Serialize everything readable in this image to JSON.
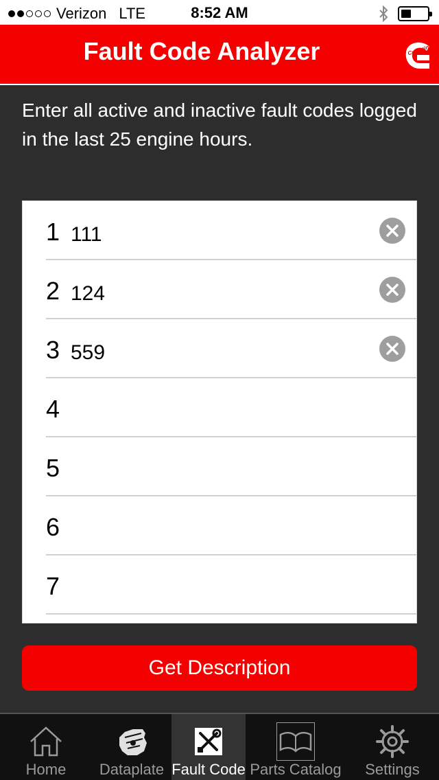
{
  "status_bar": {
    "carrier": "Verizon",
    "network": "LTE",
    "time": "8:52 AM"
  },
  "header": {
    "title": "Fault Code Analyzer",
    "logo_text": "Cummins"
  },
  "instructions": "Enter all active and inactive fault codes logged in the last 25 engine hours.",
  "codes": [
    {
      "number": "1",
      "value": "111"
    },
    {
      "number": "2",
      "value": "124"
    },
    {
      "number": "3",
      "value": "559"
    },
    {
      "number": "4",
      "value": ""
    },
    {
      "number": "5",
      "value": ""
    },
    {
      "number": "6",
      "value": ""
    },
    {
      "number": "7",
      "value": ""
    }
  ],
  "get_description_label": "Get Description",
  "tabs": [
    {
      "label": "Home",
      "icon": "home-icon"
    },
    {
      "label": "Dataplate",
      "icon": "engine-icon"
    },
    {
      "label": "Fault Code",
      "icon": "tools-icon",
      "active": true
    },
    {
      "label": "Parts Catalog",
      "icon": "book-icon"
    },
    {
      "label": "Settings",
      "icon": "gear-icon"
    }
  ],
  "colors": {
    "brand_red": "#f40000",
    "background": "#2d2d2d",
    "tab_bar": "#111111",
    "tab_active": "#333333"
  }
}
